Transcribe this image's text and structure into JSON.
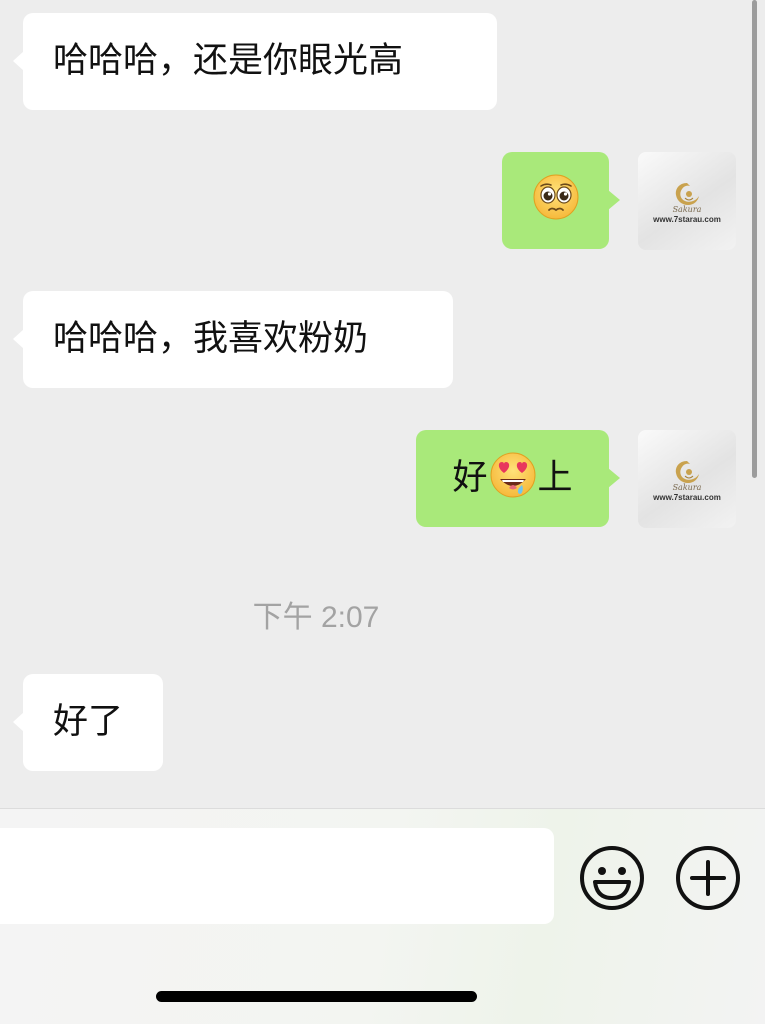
{
  "conversation": {
    "messages": [
      {
        "direction": "incoming",
        "text": "哈哈哈，还是你眼光高"
      },
      {
        "direction": "outgoing",
        "emoji": "pleading-face-emoji"
      },
      {
        "direction": "incoming",
        "text": "哈哈哈，我喜欢粉奶"
      },
      {
        "direction": "outgoing",
        "text_before": "好",
        "emoji": "heart-eyes-drooling-emoji",
        "text_after": "上"
      },
      {
        "direction": "incoming",
        "text": "好了"
      }
    ],
    "timestamp": "下午 2:07"
  },
  "avatar": {
    "brand": "Sakura",
    "site": "www.7starau.com"
  },
  "input_bar": {
    "value": "",
    "emoji_icon": "smiley-face-icon",
    "plus_icon": "plus-circle-icon"
  },
  "colors": {
    "background": "#ededed",
    "incoming_bubble": "#ffffff",
    "outgoing_bubble": "#a9e97a",
    "timestamp": "#a3a3a3"
  }
}
